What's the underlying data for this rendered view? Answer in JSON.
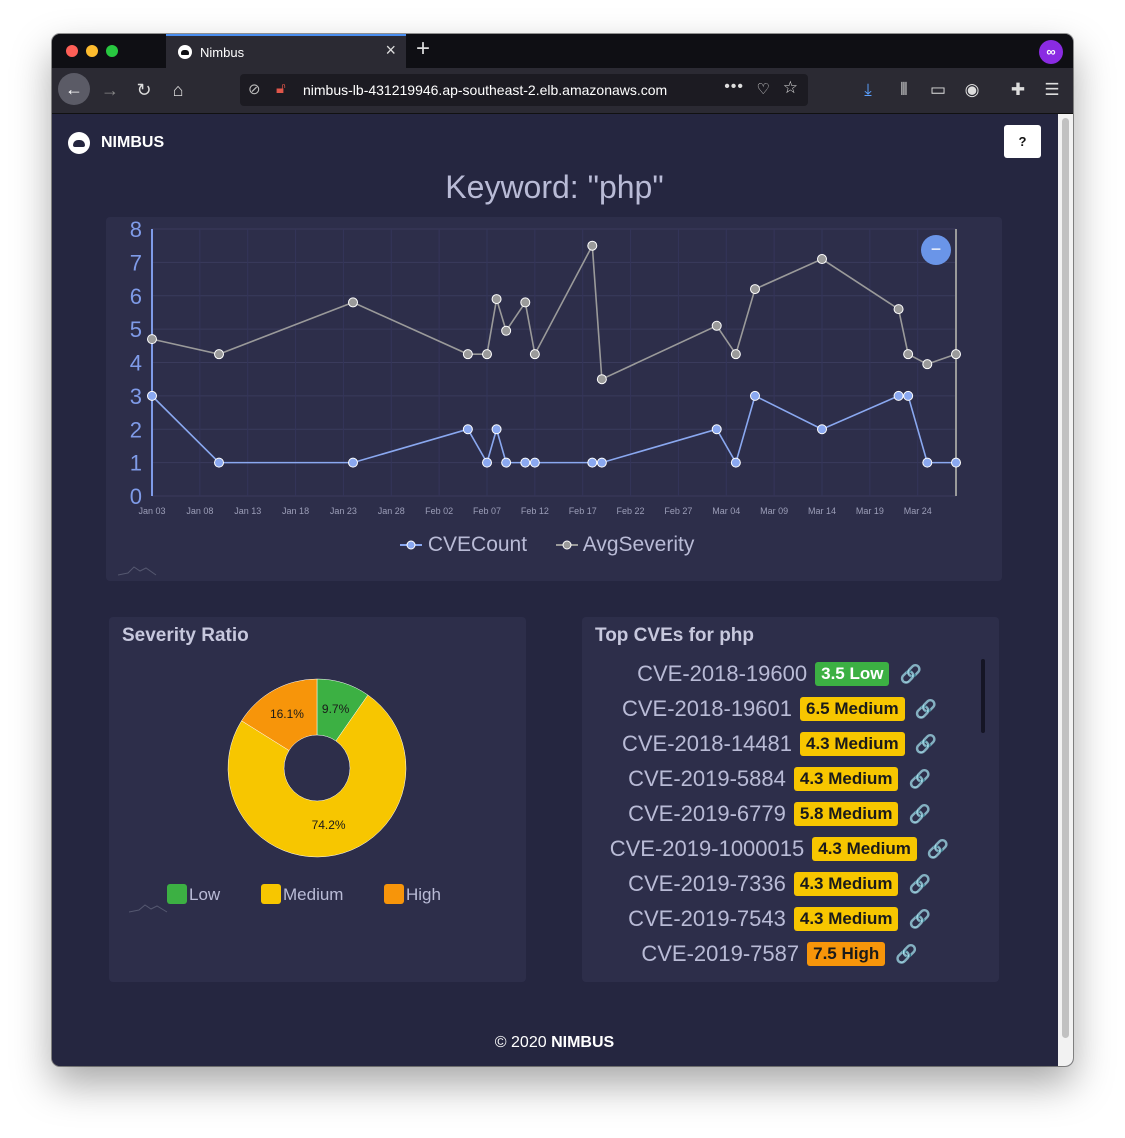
{
  "browser": {
    "tab_title": "Nimbus",
    "url": "nimbus-lb-431219946.ap-southeast-2.elb.amazonaws.com",
    "more_icon": "•••"
  },
  "header": {
    "brand": "NIMBUS",
    "help_label": "?"
  },
  "page_title": "Keyword: \"php\"",
  "chart_data": [
    {
      "type": "line",
      "x": [
        "Jan 03",
        "Jan 10",
        "Jan 24",
        "Feb 05",
        "Feb 07",
        "Feb 08",
        "Feb 09",
        "Feb 11",
        "Feb 12",
        "Feb 18",
        "Feb 19",
        "Mar 03",
        "Mar 05",
        "Mar 07",
        "Mar 14",
        "Mar 22",
        "Mar 23",
        "Mar 25",
        "Mar 28"
      ],
      "x_ticks": [
        "Jan 03",
        "Jan 08",
        "Jan 13",
        "Jan 18",
        "Jan 23",
        "Jan 28",
        "Feb 02",
        "Feb 07",
        "Feb 12",
        "Feb 17",
        "Feb 22",
        "Feb 27",
        "Mar 04",
        "Mar 09",
        "Mar 14",
        "Mar 19",
        "Mar 24"
      ],
      "y_ticks": [
        "0",
        "1",
        "2",
        "3",
        "4",
        "5",
        "6",
        "7",
        "8"
      ],
      "ylim": [
        0,
        8
      ],
      "series": [
        {
          "name": "CVECount",
          "color": "#8aa8f0",
          "values": [
            3,
            1,
            1,
            2,
            1,
            2,
            1,
            1,
            1,
            1,
            1,
            2,
            1,
            3,
            2,
            3,
            3,
            1,
            1
          ]
        },
        {
          "name": "AvgSeverity",
          "color": "#9a9a9a",
          "values": [
            4.7,
            4.25,
            5.8,
            4.25,
            4.25,
            5.9,
            4.95,
            5.8,
            4.25,
            7.5,
            3.5,
            5.1,
            4.25,
            6.2,
            7.1,
            5.6,
            4.25,
            3.95,
            4.25
          ]
        }
      ],
      "legend": "bottom",
      "grid": true
    },
    {
      "type": "pie",
      "title": "Severity Ratio",
      "categories": [
        "Low",
        "Medium",
        "High"
      ],
      "values": [
        9.7,
        74.2,
        16.1
      ],
      "value_labels": [
        "9.7%",
        "74.2%",
        "16.1%"
      ],
      "colors": [
        "#3cb043",
        "#f7c600",
        "#f7950a"
      ],
      "donut": true,
      "legend": "bottom"
    }
  ],
  "top_cves": {
    "title": "Top CVEs for php",
    "link_icon": "🔗",
    "items": [
      {
        "id": "CVE-2018-19600",
        "badge": "3.5 Low",
        "color": "#3cb043"
      },
      {
        "id": "CVE-2018-19601",
        "badge": "6.5 Medium",
        "color": "#f7c600"
      },
      {
        "id": "CVE-2018-14481",
        "badge": "4.3 Medium",
        "color": "#f7c600"
      },
      {
        "id": "CVE-2019-5884",
        "badge": "4.3 Medium",
        "color": "#f7c600"
      },
      {
        "id": "CVE-2019-6779",
        "badge": "5.8 Medium",
        "color": "#f7c600"
      },
      {
        "id": "CVE-2019-1000015",
        "badge": "4.3 Medium",
        "color": "#f7c600"
      },
      {
        "id": "CVE-2019-7336",
        "badge": "4.3 Medium",
        "color": "#f7c600"
      },
      {
        "id": "CVE-2019-7543",
        "badge": "4.3 Medium",
        "color": "#f7c600"
      },
      {
        "id": "CVE-2019-7587",
        "badge": "7.5 High",
        "color": "#f7950a"
      }
    ]
  },
  "footer": {
    "copyright": "© 2020",
    "brand": "NIMBUS"
  }
}
